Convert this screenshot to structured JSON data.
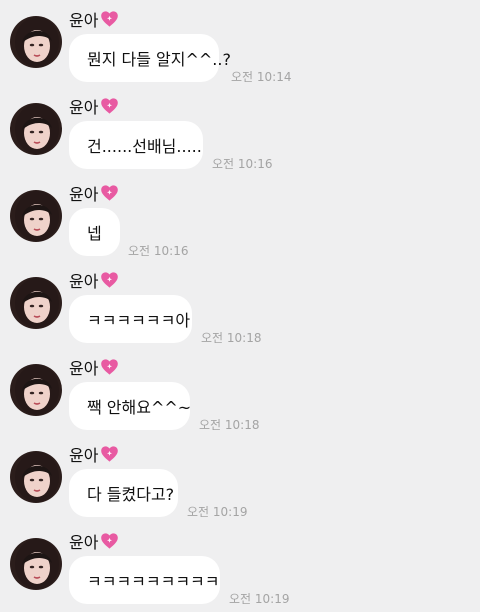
{
  "sender": {
    "name": "윤아",
    "heart_icon": "pink-sparkling-heart-icon"
  },
  "messages": [
    {
      "text": "뭔지 다들 알지^^..?",
      "time": "오전 10:14"
    },
    {
      "text": "건......선배님.....",
      "time": "오전 10:16"
    },
    {
      "text": "넵",
      "time": "오전 10:16"
    },
    {
      "text": "ㅋㅋㅋㅋㅋㅋ아",
      "time": "오전 10:18"
    },
    {
      "text": "짹 안해요^^~",
      "time": "오전 10:18"
    },
    {
      "text": "다 들켰다고?",
      "time": "오전 10:19"
    },
    {
      "text": "ㅋㅋㅋㅋㅋㅋㅋㅋㅋ",
      "time": "오전 10:19"
    }
  ],
  "colors": {
    "background": "#efeff0",
    "bubble": "#ffffff",
    "heart": "#e85aa2",
    "timestamp": "#a4a4a4"
  }
}
